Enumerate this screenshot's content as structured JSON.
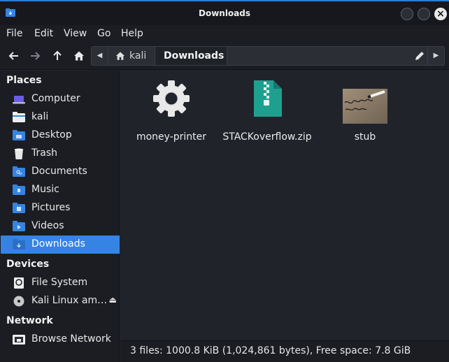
{
  "window": {
    "title": "Downloads"
  },
  "menu": [
    "File",
    "Edit",
    "View",
    "Go",
    "Help"
  ],
  "path": {
    "home": "kali",
    "current": "Downloads"
  },
  "sidebar": {
    "places_label": "Places",
    "places": [
      {
        "label": "Computer",
        "icon": "computer-icon"
      },
      {
        "label": "kali",
        "icon": "home-folder-icon"
      },
      {
        "label": "Desktop",
        "icon": "desktop-folder-icon"
      },
      {
        "label": "Trash",
        "icon": "trash-icon"
      },
      {
        "label": "Documents",
        "icon": "documents-folder-icon"
      },
      {
        "label": "Music",
        "icon": "music-folder-icon"
      },
      {
        "label": "Pictures",
        "icon": "pictures-folder-icon"
      },
      {
        "label": "Videos",
        "icon": "videos-folder-icon"
      },
      {
        "label": "Downloads",
        "icon": "downloads-folder-icon",
        "active": true
      }
    ],
    "devices_label": "Devices",
    "devices": [
      {
        "label": "File System",
        "icon": "drive-icon"
      },
      {
        "label": "Kali Linux am…",
        "icon": "disc-icon"
      }
    ],
    "network_label": "Network",
    "network": [
      {
        "label": "Browse Network",
        "icon": "network-icon"
      }
    ]
  },
  "files": [
    {
      "name": "money-printer",
      "icon": "gear-icon"
    },
    {
      "name": "STACKoverflow.zip",
      "icon": "zip-archive-icon"
    },
    {
      "name": "stub",
      "icon": "image-thumbnail-icon"
    }
  ],
  "status": "3 files: 1000.8 KiB (1,024,861 bytes), Free space: 7.8 GiB",
  "colors": {
    "accent": "#3584e4",
    "window_bg": "#20232a",
    "sidebar_bg": "#1b1d22"
  }
}
